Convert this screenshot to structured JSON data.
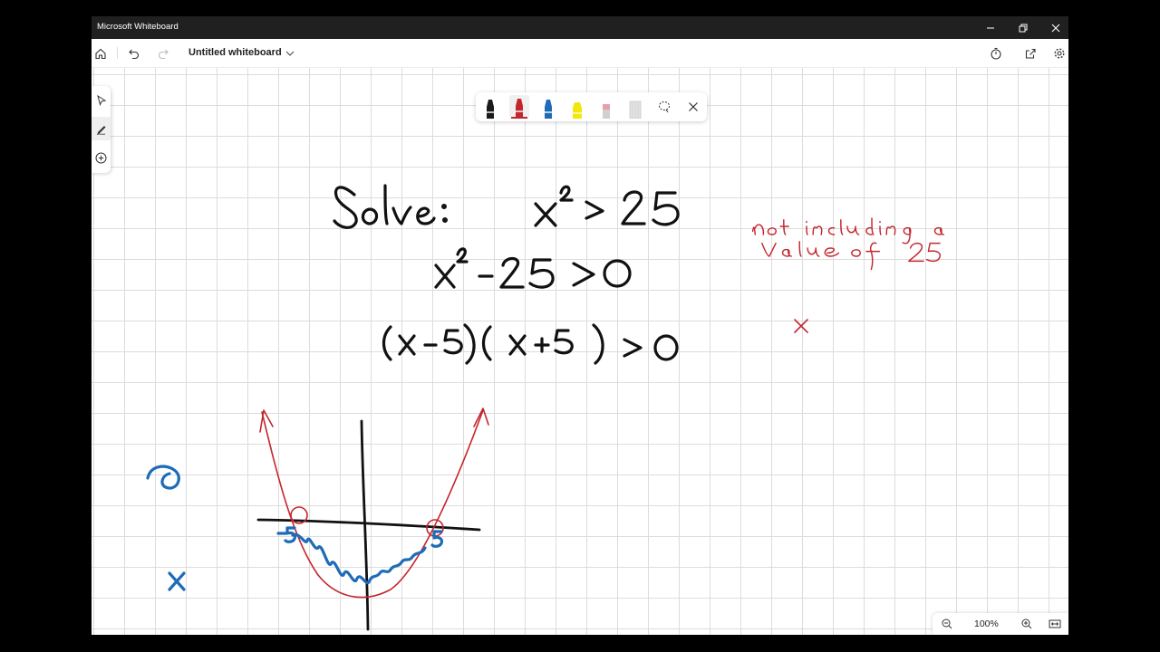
{
  "window": {
    "title": "Microsoft Whiteboard"
  },
  "toolbar": {
    "board_name": "Untitled whiteboard"
  },
  "zoom": {
    "level": "100%"
  },
  "pens": [
    {
      "name": "black-pen",
      "color": "#1a1a1a",
      "active": false
    },
    {
      "name": "red-pen",
      "color": "#c4262e",
      "active": true
    },
    {
      "name": "blue-pen",
      "color": "#1e6bb8",
      "active": false
    },
    {
      "name": "yellow-highlighter",
      "color": "#f2e60f",
      "active": false
    },
    {
      "name": "eraser",
      "color": "#e8a0a8",
      "active": false
    },
    {
      "name": "ruler",
      "color": "#d6d6d6",
      "active": false
    }
  ],
  "ink_colors": {
    "black": "#111111",
    "red": "#c4262e",
    "blue": "#1e6bb8"
  },
  "handwriting": {
    "line1_left": "Solve:",
    "line1_right": "x² > 25",
    "line2": "x² - 25 > 0",
    "line3": "(x-5)(x+5) > 0",
    "note_line1": "not including a",
    "note_line2": "value of 25",
    "note_x": "x",
    "blue_y": "y",
    "blue_x": "x",
    "root_neg": "-5",
    "root_pos": "5"
  }
}
